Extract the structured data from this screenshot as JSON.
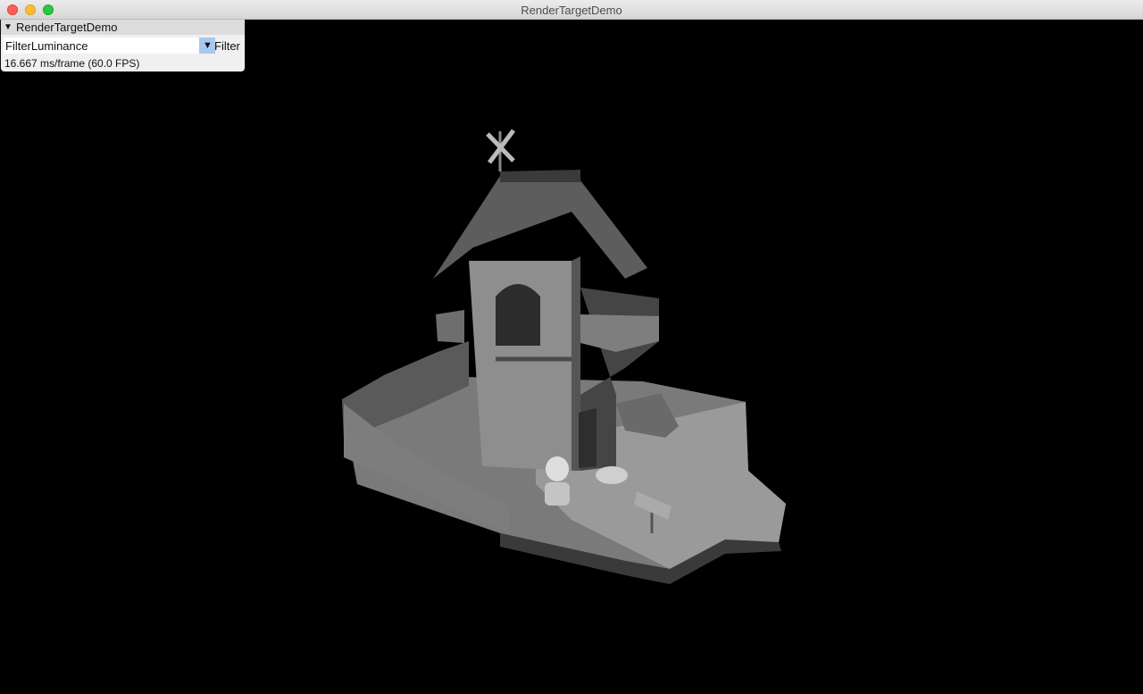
{
  "window": {
    "title": "RenderTargetDemo"
  },
  "panel": {
    "title": "RenderTargetDemo",
    "collapse_icon": "triangle-down-icon",
    "filter_combo": {
      "value": "FilterLuminance",
      "label": "Filter"
    },
    "frame_stats": "16.667 ms/frame (60.0 FPS)"
  },
  "colors": {
    "background": "#000000",
    "panel": "#f0f0f0",
    "combo_button": "#a9c8ee"
  }
}
